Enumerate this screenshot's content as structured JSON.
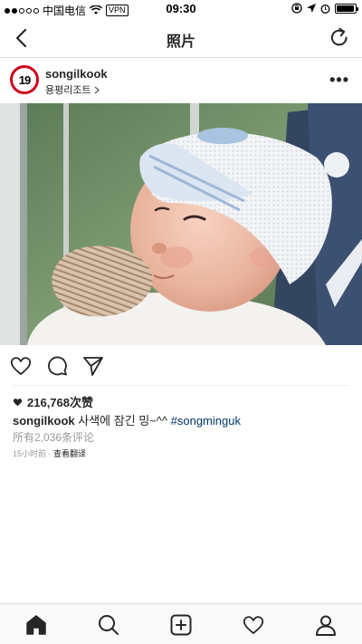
{
  "status_bar": {
    "carrier": "中国电信",
    "vpn": "VPN",
    "time": "09:30",
    "battery_level": 0.95,
    "signal_bars_filled": 2,
    "signal_bars_total": 5
  },
  "nav": {
    "title": "照片",
    "back_icon": "chevron-left-icon",
    "refresh_icon": "refresh-icon"
  },
  "post": {
    "avatar_text": "19",
    "username": "songilkook",
    "location": "용평리조트",
    "more_label": "•••",
    "likes": "216,768次赞",
    "caption_user": "songilkook",
    "caption_text": " 사색에 잠긴 밍~^^ ",
    "caption_hashtag": "#songminguk",
    "comments_link": "所有2,036条评论",
    "time_ago": "15小时前",
    "separator": " · ",
    "translate_label": "查看翻译"
  },
  "colors": {
    "accent_blue": "#003569",
    "avatar_ring": "#d0021b",
    "muted": "#999999"
  },
  "tab_bar": {
    "items": [
      "home-icon",
      "search-icon",
      "add-icon",
      "heart-icon",
      "profile-icon"
    ],
    "active": "home-icon"
  }
}
